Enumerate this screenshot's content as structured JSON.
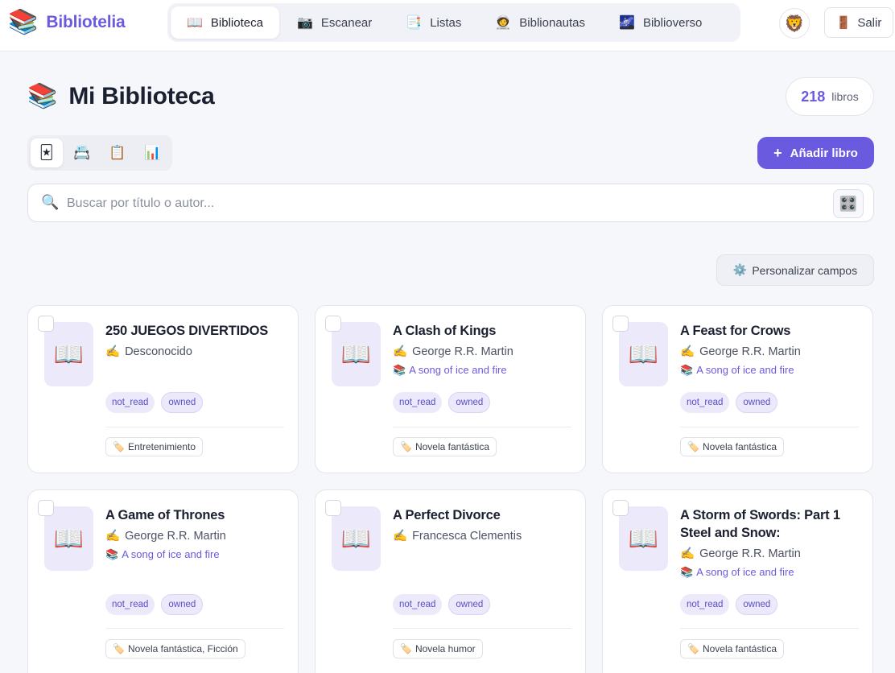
{
  "app": {
    "name": "Bibliotelia",
    "logo_icon": "📚"
  },
  "nav": {
    "items": [
      {
        "icon": "📖",
        "label": "Biblioteca",
        "active": true
      },
      {
        "icon": "📷",
        "label": "Escanear",
        "active": false
      },
      {
        "icon": "📑",
        "label": "Listas",
        "active": false
      },
      {
        "icon": "🧑‍🚀",
        "label": "Biblionautas",
        "active": false
      },
      {
        "icon": "🌌",
        "label": "Biblioverso",
        "active": false
      }
    ],
    "avatar_icon": "🦁",
    "logout_icon": "🚪",
    "logout_label": "Salir"
  },
  "header": {
    "title_icon": "📚",
    "title": "Mi Biblioteca",
    "count": "218",
    "count_label": "libros"
  },
  "views": [
    {
      "icon": "🃏",
      "name": "cards-view-icon",
      "active": true
    },
    {
      "icon": "📇",
      "name": "rolodex-view-icon",
      "active": false
    },
    {
      "icon": "📋",
      "name": "list-view-icon",
      "active": false
    },
    {
      "icon": "📊",
      "name": "stats-view-icon",
      "active": false
    }
  ],
  "add_button": {
    "icon": "+",
    "label": "Añadir libro"
  },
  "search": {
    "icon": "🔍",
    "placeholder": "Buscar por título o autor...",
    "value": "",
    "scan_icon": "🎛️"
  },
  "customize": {
    "icon": "⚙️",
    "label": "Personalizar campos"
  },
  "books": [
    {
      "cover_icon": "📖",
      "title": "250 JUEGOS DIVERTIDOS",
      "author_icon": "✍️",
      "author": "Desconocido",
      "series_icon": "",
      "series": "",
      "status": "not_read",
      "ownership": "owned",
      "genre_icon": "🏷️",
      "genre": "Entretenimiento"
    },
    {
      "cover_icon": "📖",
      "title": "A Clash of Kings",
      "author_icon": "✍️",
      "author": "George R.R. Martin",
      "series_icon": "📚",
      "series": "A song of ice and fire",
      "status": "not_read",
      "ownership": "owned",
      "genre_icon": "🏷️",
      "genre": "Novela fantástica"
    },
    {
      "cover_icon": "📖",
      "title": "A Feast for Crows",
      "author_icon": "✍️",
      "author": "George R.R. Martin",
      "series_icon": "📚",
      "series": "A song of ice and fire",
      "status": "not_read",
      "ownership": "owned",
      "genre_icon": "🏷️",
      "genre": "Novela fantástica"
    },
    {
      "cover_icon": "📖",
      "title": "A Game of Thrones",
      "author_icon": "✍️",
      "author": "George R.R. Martin",
      "series_icon": "📚",
      "series": "A song of ice and fire",
      "status": "not_read",
      "ownership": "owned",
      "genre_icon": "🏷️",
      "genre": "Novela fantástica, Ficción"
    },
    {
      "cover_icon": "📖",
      "title": "A Perfect Divorce",
      "author_icon": "✍️",
      "author": "Francesca Clementis",
      "series_icon": "",
      "series": "",
      "status": "not_read",
      "ownership": "owned",
      "genre_icon": "🏷️",
      "genre": "Novela humor"
    },
    {
      "cover_icon": "📖",
      "title": "A Storm of Swords: Part 1 Steel and Snow:",
      "author_icon": "✍️",
      "author": "George R.R. Martin",
      "series_icon": "📚",
      "series": "A song of ice and fire",
      "status": "not_read",
      "ownership": "owned",
      "genre_icon": "🏷️",
      "genre": "Novela fantástica"
    }
  ]
}
